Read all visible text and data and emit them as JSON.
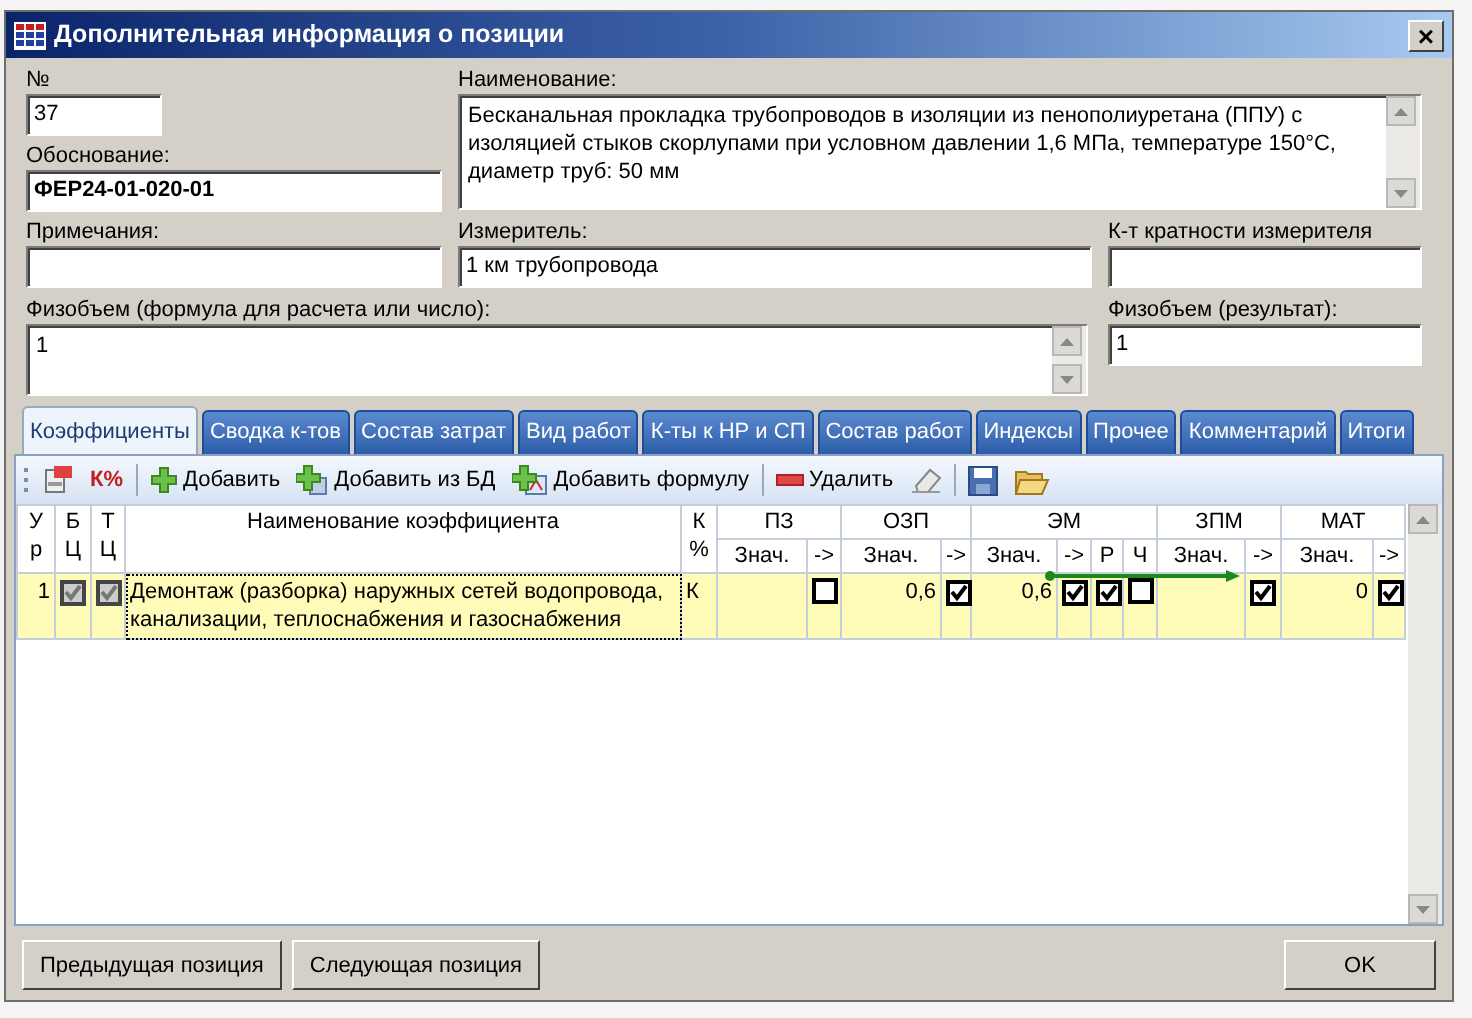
{
  "window": {
    "title": "Дополнительная информация о позиции",
    "close": "×"
  },
  "number": {
    "label": "№",
    "value": "37"
  },
  "name": {
    "label": "Наименование:",
    "value": "Бесканальная прокладка трубопроводов в изоляции из пенополиуретана (ППУ) с изоляцией стыков скорлупами при условном давлении 1,6 МПа, температуре 150°С, диаметр труб: 50 мм"
  },
  "basis": {
    "label": "Обоснование:",
    "value": "ФЕР24-01-020-01"
  },
  "notes": {
    "label": "Примечания:"
  },
  "unit": {
    "label": "Измеритель:",
    "value": "1 км трубопровода"
  },
  "ratio": {
    "label": "К-т кратности измерителя"
  },
  "volume_formula": {
    "label": "Физобъем (формула для расчета или число):",
    "value": "1"
  },
  "volume_result": {
    "label": "Физобъем (результат):",
    "value": "1"
  },
  "tabs": [
    {
      "label": "Коэффициенты",
      "selected": true
    },
    {
      "label": "Сводка к-тов",
      "selected": false
    },
    {
      "label": "Состав затрат",
      "selected": false
    },
    {
      "label": "Вид работ",
      "selected": false
    },
    {
      "label": "К-ты к НР и СП",
      "selected": false
    },
    {
      "label": "Состав работ",
      "selected": false
    },
    {
      "label": "Индексы",
      "selected": false
    },
    {
      "label": "Прочее",
      "selected": false
    },
    {
      "label": "Комментарий",
      "selected": false
    },
    {
      "label": "Итоги",
      "selected": false
    }
  ],
  "toolbar": [
    {
      "kind": "grip"
    },
    {
      "kind": "props"
    },
    {
      "kind": "percent",
      "label": "К%"
    },
    {
      "kind": "sep"
    },
    {
      "kind": "add",
      "label": "Добавить"
    },
    {
      "kind": "adddb",
      "label": "Добавить из БД"
    },
    {
      "kind": "addformula",
      "label": "Добавить формулу"
    },
    {
      "kind": "sep"
    },
    {
      "kind": "delete",
      "label": "Удалить"
    },
    {
      "kind": "eraser"
    },
    {
      "kind": "sep"
    },
    {
      "kind": "save"
    },
    {
      "kind": "open"
    }
  ],
  "columns": [
    {
      "label": "У р"
    },
    {
      "label": "Б Ц"
    },
    {
      "label": "Т Ц"
    },
    {
      "label": "Наименование коэффициента"
    },
    {
      "label": "К %"
    },
    {
      "label": "ПЗ",
      "sub": [
        "Знач.",
        "->"
      ]
    },
    {
      "label": "ОЗП",
      "sub": [
        "Знач.",
        "->"
      ]
    },
    {
      "label": "ЭМ",
      "sub": [
        "Знач.",
        "->",
        "Р",
        "Ч"
      ]
    },
    {
      "label": "ЗПМ",
      "sub": [
        "Знач.",
        "->"
      ]
    },
    {
      "label": "МАТ",
      "sub": [
        "Знач.",
        "->"
      ]
    }
  ],
  "rows": [
    {
      "selected": true,
      "cells": [
        {
          "kind": "num",
          "text": "1"
        },
        {
          "kind": "check",
          "checked": true,
          "disabled": true
        },
        {
          "kind": "check",
          "checked": true,
          "disabled": true
        },
        {
          "kind": "name",
          "text": "Демонтаж (разборка) наружных сетей водопровода, канализации, теплоснабжения и газоснабжения"
        },
        {
          "kind": "text",
          "text": "К"
        },
        {
          "kind": "empty"
        },
        {
          "kind": "check",
          "checked": false
        },
        {
          "kind": "num",
          "text": "0,6"
        },
        {
          "kind": "check",
          "checked": true
        },
        {
          "kind": "num",
          "text": "0,6"
        },
        {
          "kind": "check",
          "checked": true
        },
        {
          "kind": "check",
          "checked": true
        },
        {
          "kind": "check",
          "checked": false
        },
        {
          "kind": "empty"
        },
        {
          "kind": "check",
          "checked": true
        },
        {
          "kind": "num",
          "text": "0"
        },
        {
          "kind": "check",
          "checked": true
        }
      ]
    }
  ],
  "buttons": {
    "prev": "Предыдущая позиция",
    "next": "Следующая позиция",
    "ok": "OK"
  }
}
